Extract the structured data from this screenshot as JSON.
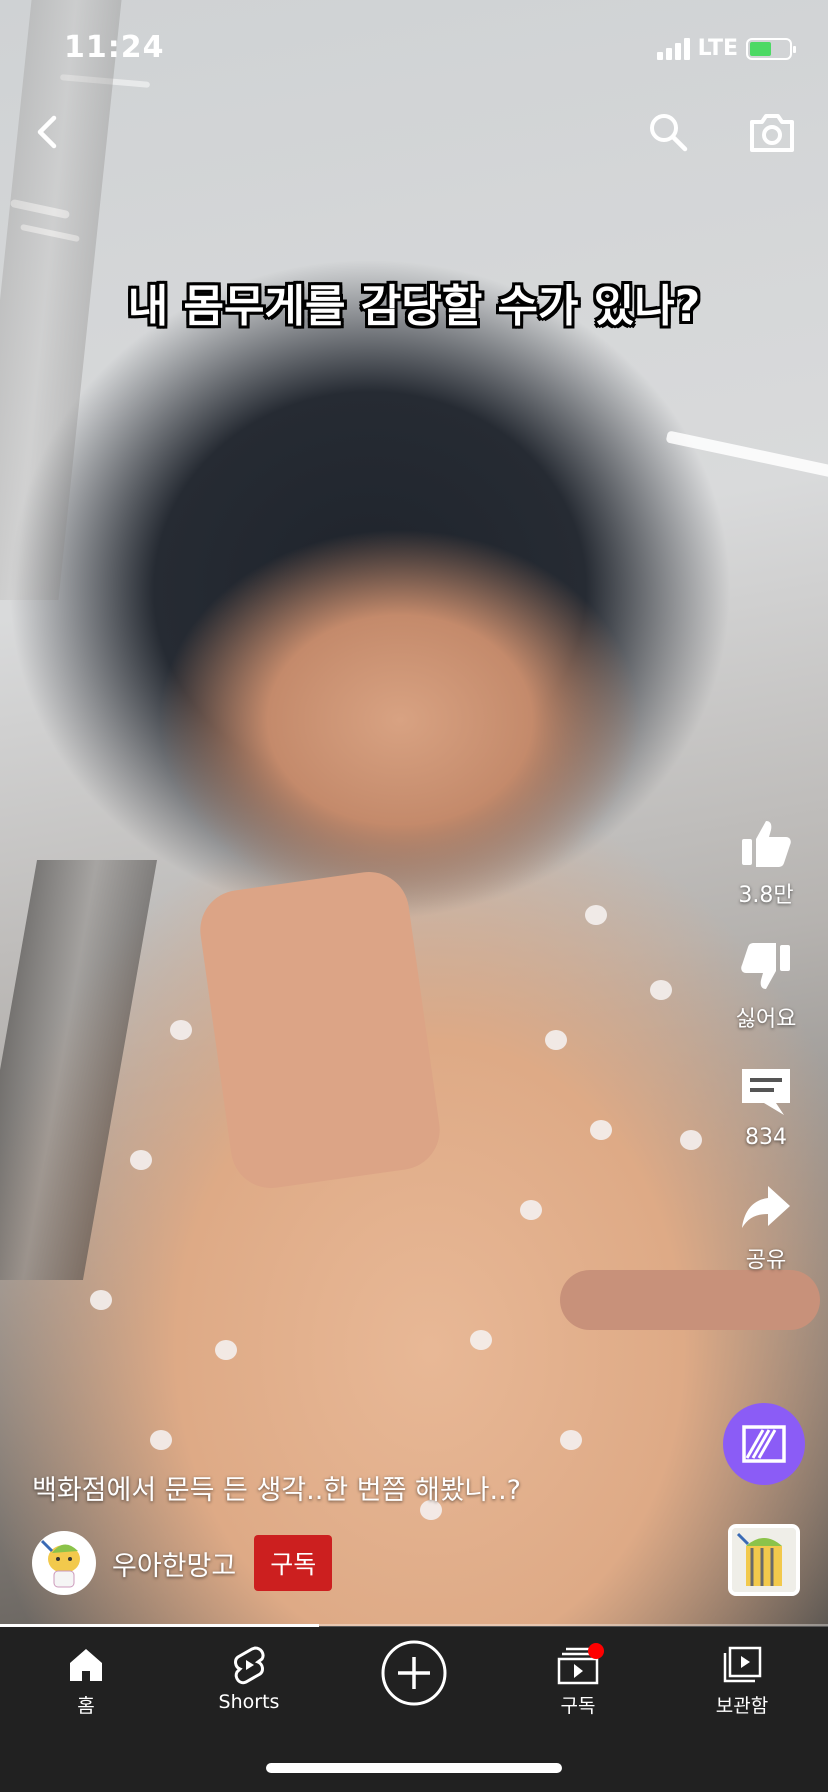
{
  "status_bar": {
    "time": "11:24",
    "network": "LTE",
    "battery_charging": true
  },
  "video": {
    "caption": "내 몸무게를 감당할 수가 있나?",
    "title": "백화점에서 문득 든 생각..한 번쯤 해봤나..?",
    "progress_fraction": 0.385
  },
  "top_bar": {
    "back_icon": "chevron-left-icon",
    "search_icon": "search-icon",
    "camera_icon": "camera-icon"
  },
  "actions": {
    "like": {
      "icon": "thumbs-up-icon",
      "label": "3.8만"
    },
    "dislike": {
      "icon": "thumbs-down-icon",
      "label": "싫어요"
    },
    "comments": {
      "icon": "comment-icon",
      "label": "834"
    },
    "share": {
      "icon": "share-icon",
      "label": "공유"
    },
    "remix": {
      "icon": "remix-icon",
      "color": "#8b5cf6"
    }
  },
  "channel": {
    "name": "우아한망고",
    "subscribe_label": "구독",
    "subscribe_color": "#cc1f1f"
  },
  "bottom_nav": {
    "items": [
      {
        "label": "홈",
        "icon": "home-icon"
      },
      {
        "label": "Shorts",
        "icon": "shorts-icon"
      },
      {
        "label": "",
        "icon": "create-plus-icon"
      },
      {
        "label": "구독",
        "icon": "subscriptions-icon",
        "badge": true
      },
      {
        "label": "보관함",
        "icon": "library-icon"
      }
    ]
  }
}
